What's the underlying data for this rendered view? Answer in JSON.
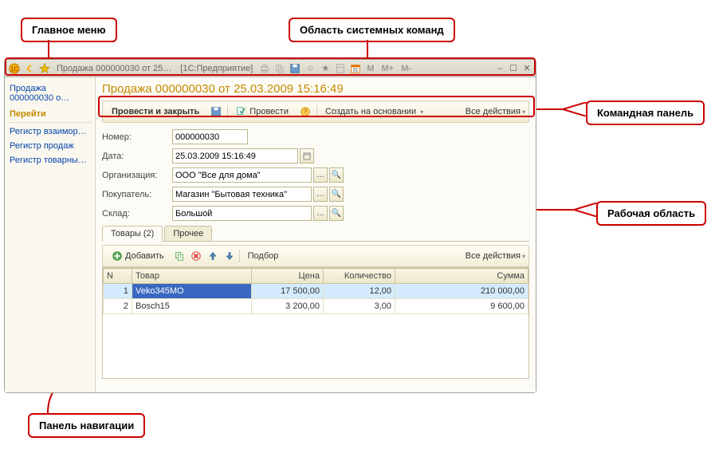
{
  "callouts": {
    "main_menu": "Главное меню",
    "system_commands": "Область системных команд",
    "command_panel": "Командная панель",
    "work_area": "Рабочая область",
    "nav_panel": "Панель навигации"
  },
  "titlebar": {
    "doc_abbr": "Продажа 000000030 от 25…",
    "app_suffix": "[1С:Предприятие]",
    "m1": "M",
    "m2": "M+",
    "m3": "M-"
  },
  "nav": {
    "breadcrumb": "Продажа 000000030 о…",
    "section": "Перейти",
    "links": {
      "0": "Регистр взаиморасчетов …",
      "1": "Регистр продаж",
      "2": "Регистр товарных запасов"
    }
  },
  "doc": {
    "title": "Продажа 000000030 от 25.03.2009 15:16:49"
  },
  "cmd": {
    "post_close": "Провести и закрыть",
    "post": "Провести",
    "create_based": "Создать на основании",
    "all_actions": "Все действия"
  },
  "form": {
    "number_label": "Номер:",
    "number_value": "000000030",
    "date_label": "Дата:",
    "date_value": "25.03.2009 15:16:49",
    "org_label": "Организация:",
    "org_value": "ООО \"Все для дома\"",
    "buyer_label": "Покупатель:",
    "buyer_value": "Магазин \"Бытовая техника\"",
    "warehouse_label": "Склад:",
    "warehouse_value": "Большой"
  },
  "tabs": {
    "goods": "Товары (2)",
    "other": "Прочее"
  },
  "grid_toolbar": {
    "add": "Добавить",
    "pick": "Подбор",
    "all_actions": "Все действия"
  },
  "table": {
    "col_n": "N",
    "col_product": "Товар",
    "col_price": "Цена",
    "col_qty": "Количество",
    "col_sum": "Сумма",
    "rows": {
      "0": {
        "n": "1",
        "product": "Veko345MO",
        "price": "17 500,00",
        "qty": "12,00",
        "sum": "210 000,00"
      },
      "1": {
        "n": "2",
        "product": "Bosch15",
        "price": "3 200,00",
        "qty": "3,00",
        "sum": "9 600,00"
      }
    }
  }
}
